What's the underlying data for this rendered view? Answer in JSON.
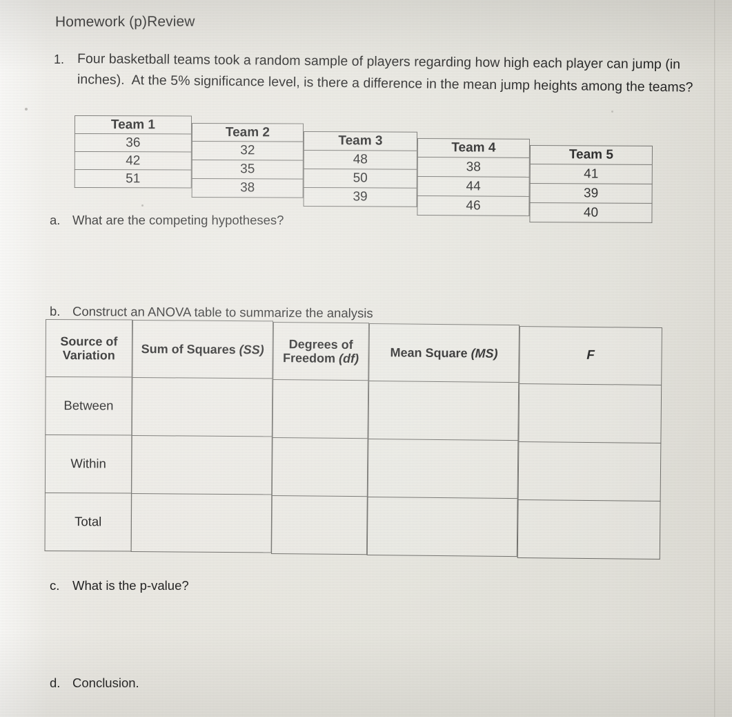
{
  "document": {
    "title": "Homework (p)Review",
    "question_number": "1.",
    "question_lines": [
      "Four basketball teams took a random sample of players regarding how high each player can jump (in",
      "inches).  At the 5% significance level, is there a difference in the mean jump heights among the teams?"
    ]
  },
  "parts": {
    "a": {
      "letter": "a.",
      "text": "What are the competing hypotheses?"
    },
    "b": {
      "letter": "b.",
      "text": "Construct an ANOVA table to summarize the analysis"
    },
    "c": {
      "letter": "c.",
      "text": "What is the p-value?"
    },
    "d": {
      "letter": "d.",
      "text": "Conclusion."
    }
  },
  "data_table": {
    "headers": [
      "Team 1",
      "Team 2",
      "Team 3",
      "Team 4",
      "Team 5"
    ],
    "columns": [
      [
        "36",
        "42",
        "51"
      ],
      [
        "32",
        "35",
        "38"
      ],
      [
        "48",
        "50",
        "39"
      ],
      [
        "38",
        "44",
        "46"
      ],
      [
        "41",
        "39",
        "40"
      ]
    ]
  },
  "anova_table": {
    "headers": [
      {
        "line1": "Source of",
        "line2": "Variation"
      },
      {
        "line1": "Sum of Squares",
        "italic": "(SS)"
      },
      {
        "line1": "Degrees of",
        "line2": "Freedom",
        "italic": "(df)"
      },
      {
        "line1": "Mean Square",
        "italic": "(MS)"
      },
      {
        "line1": "",
        "italic": "F"
      }
    ],
    "rows": [
      {
        "label": "Between",
        "ss": "",
        "df": "",
        "ms": "",
        "f": ""
      },
      {
        "label": "Within",
        "ss": "",
        "df": "",
        "ms": "",
        "f": ""
      },
      {
        "label": "Total",
        "ss": "",
        "df": "",
        "ms": "",
        "f": ""
      }
    ]
  },
  "colors": {
    "paper": "#ecebe5",
    "ink": "#1b1b1b",
    "rule": "#6e6d69"
  }
}
